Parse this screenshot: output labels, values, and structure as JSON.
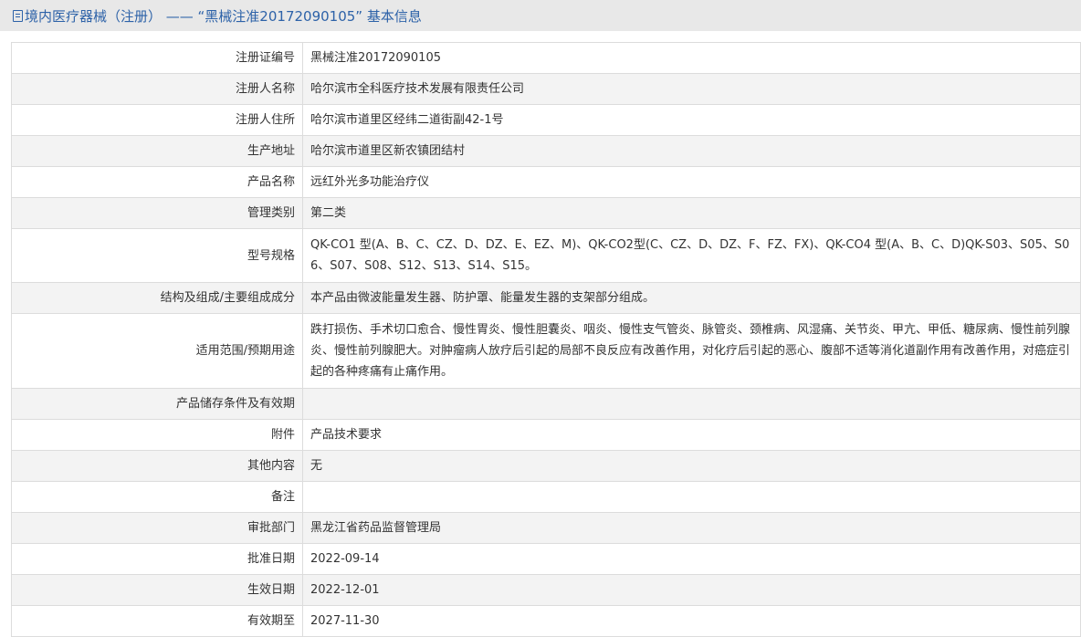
{
  "header": {
    "title": "境内医疗器械（注册） ——  “黑械注准20172090105” 基本信息"
  },
  "rows": [
    {
      "label": "注册证编号",
      "value": "黑械注准20172090105"
    },
    {
      "label": "注册人名称",
      "value": "哈尔滨市全科医疗技术发展有限责任公司"
    },
    {
      "label": "注册人住所",
      "value": "哈尔滨市道里区经纬二道街副42-1号"
    },
    {
      "label": "生产地址",
      "value": "哈尔滨市道里区新农镇团结村"
    },
    {
      "label": "产品名称",
      "value": "远红外光多功能治疗仪"
    },
    {
      "label": "管理类别",
      "value": "第二类"
    },
    {
      "label": "型号规格",
      "value": "QK-CO1 型(A、B、C、CZ、D、DZ、E、EZ、M)、QK-CO2型(C、CZ、D、DZ、F、FZ、FX)、QK-CO4 型(A、B、C、D)QK-S03、S05、S06、S07、S08、S12、S13、S14、S15。"
    },
    {
      "label": "结构及组成/主要组成成分",
      "value": "本产品由微波能量发生器、防护罩、能量发生器的支架部分组成。"
    },
    {
      "label": "适用范围/预期用途",
      "value": "跌打损伤、手术切口愈合、慢性胃炎、慢性胆囊炎、咽炎、慢性支气管炎、脉管炎、颈椎病、风湿痛、关节炎、甲亢、甲低、糖尿病、慢性前列腺炎、慢性前列腺肥大。对肿瘤病人放疗后引起的局部不良反应有改善作用，对化疗后引起的恶心、腹部不适等消化道副作用有改善作用，对癌症引起的各种疼痛有止痛作用。"
    },
    {
      "label": "产品储存条件及有效期",
      "value": ""
    },
    {
      "label": "附件",
      "value": "产品技术要求"
    },
    {
      "label": "其他内容",
      "value": "无"
    },
    {
      "label": "备注",
      "value": ""
    },
    {
      "label": "审批部门",
      "value": "黑龙江省药品监督管理局"
    },
    {
      "label": "批准日期",
      "value": "2022-09-14"
    },
    {
      "label": "生效日期",
      "value": "2022-12-01"
    },
    {
      "label": "有效期至",
      "value": "2027-11-30"
    }
  ]
}
